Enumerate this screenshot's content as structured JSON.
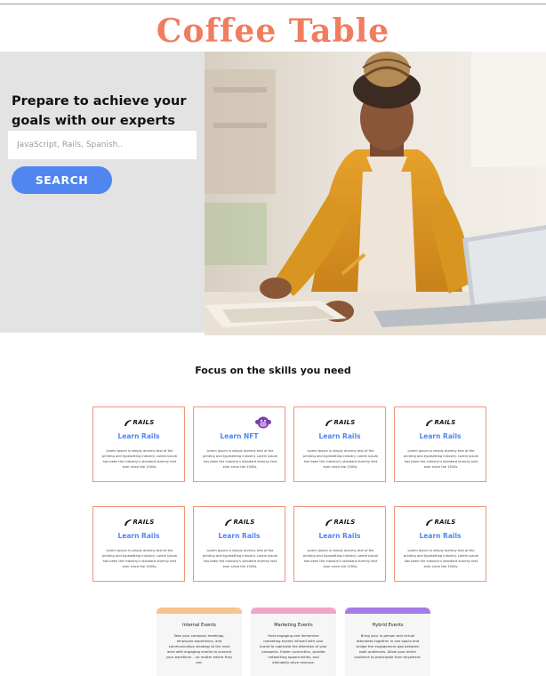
{
  "brand": "Coffee Table",
  "hero": {
    "title": "Prepare to achieve your goals with our experts",
    "search_placeholder": "JavaScript, Rails, Spanish..",
    "search_button": "SEARCH"
  },
  "skills": {
    "heading": "Focus on the skills you need",
    "logo_text": "RAILS",
    "cards": [
      {
        "title": "Learn Rails",
        "icon": "rails-logo-icon",
        "desc": "Lorem Ipsum is simply dummy text of the printing and typesetting industry. Lorem Ipsum has been the industry's standard dummy text ever since the 1500s."
      },
      {
        "title": "Learn NFT",
        "icon": "nft-monkey-icon",
        "desc": "Lorem Ipsum is simply dummy text of the printing and typesetting industry. Lorem Ipsum has been the industry's standard dummy text ever since the 1500s."
      },
      {
        "title": "Learn Rails",
        "icon": "rails-logo-icon",
        "desc": "Lorem Ipsum is simply dummy text of the printing and typesetting industry. Lorem Ipsum has been the industry's standard dummy text ever since the 1500s."
      },
      {
        "title": "Learn Rails",
        "icon": "rails-logo-icon",
        "desc": "Lorem Ipsum is simply dummy text of the printing and typesetting industry. Lorem Ipsum has been the industry's standard dummy text ever since the 1500s."
      },
      {
        "title": "Learn Rails",
        "icon": "rails-logo-icon",
        "desc": "Lorem Ipsum is simply dummy text of the printing and typesetting industry. Lorem Ipsum has been the industry's standard dummy text ever since the 1500s."
      },
      {
        "title": "Learn Rails",
        "icon": "rails-logo-icon",
        "desc": "Lorem Ipsum is simply dummy text of the printing and typesetting industry. Lorem Ipsum has been the industry's standard dummy text ever since the 1500s."
      },
      {
        "title": "Learn Rails",
        "icon": "rails-logo-icon",
        "desc": "Lorem Ipsum is simply dummy text of the printing and typesetting industry. Lorem Ipsum has been the industry's standard dummy text ever since the 1500s."
      },
      {
        "title": "Learn Rails",
        "icon": "rails-logo-icon",
        "desc": "Lorem Ipsum is simply dummy text of the printing and typesetting industry. Lorem Ipsum has been the industry's standard dummy text ever since the 1500s."
      }
    ]
  },
  "events": [
    {
      "title": "Internal Events",
      "color": "#f5c48f",
      "desc": "Take your company meetings, employee experience, and communication strategy to the next level with engaging events to connect your workforce – no matter where they are."
    },
    {
      "title": "Marketing Events",
      "color": "#f2a5c6",
      "desc": "Host engaging and immersive marketing events infused with your brand to captivate the attention of your prospects. Foster connection, provide networking opportunities, and ultimately drive revenue."
    },
    {
      "title": "Hybrid Events",
      "color": "#a57de8",
      "desc": "Bring your in-person and virtual attendees together in one space and bridge the engagement gap between both audiences. Allow your entire audience to participate from anywhere."
    }
  ],
  "colors": {
    "brand": "#f07d5f",
    "accent": "#4f86ef",
    "card_border": "#f0957b",
    "hero_bg": "#e3e3e3"
  }
}
